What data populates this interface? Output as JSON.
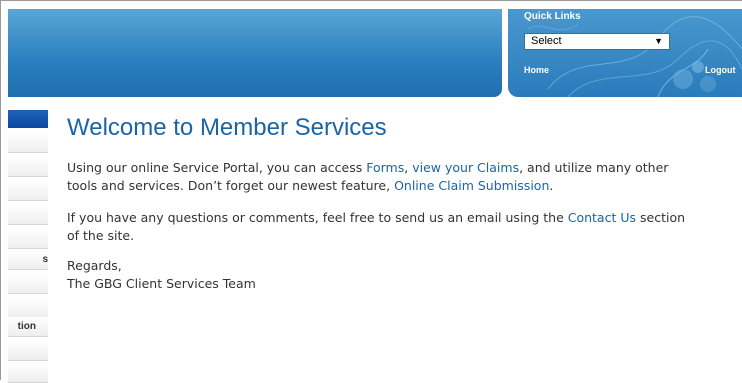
{
  "quick_links": {
    "title": "Quick Links",
    "select_value": "Select",
    "home_label": "Home",
    "logout_label": "Logout"
  },
  "sidebar": {
    "items": [
      {
        "label": ""
      },
      {
        "label": ""
      },
      {
        "label": ""
      },
      {
        "label": ""
      },
      {
        "label": ""
      },
      {
        "label": "s"
      },
      {
        "label": ""
      },
      {
        "label": ""
      },
      {
        "label": "tion"
      },
      {
        "label": ""
      },
      {
        "label": ""
      }
    ]
  },
  "main": {
    "title": "Welcome to Member Services",
    "para1": {
      "t1": "Using our online Service Portal, you can access ",
      "link_forms": "Forms",
      "t2": ", ",
      "link_claims": "view your Claims",
      "t3": ", and utilize many other",
      "t4": "tools and services. Don’t forget our newest feature, ",
      "link_submission": "Online Claim Submission",
      "t5": "."
    },
    "para2": {
      "t1": "If you have any questions or comments, feel free to send us an email using the ",
      "link_contact": "Contact Us",
      "t2": " section",
      "t3": "of the site."
    },
    "closing": {
      "regards": "Regards,",
      "team": "The GBG Client Services Team"
    }
  },
  "colors": {
    "header_blue": "#2a7fbe",
    "link_blue": "#1b64a6",
    "nav_active": "#0d4aa0",
    "text": "#333333"
  }
}
